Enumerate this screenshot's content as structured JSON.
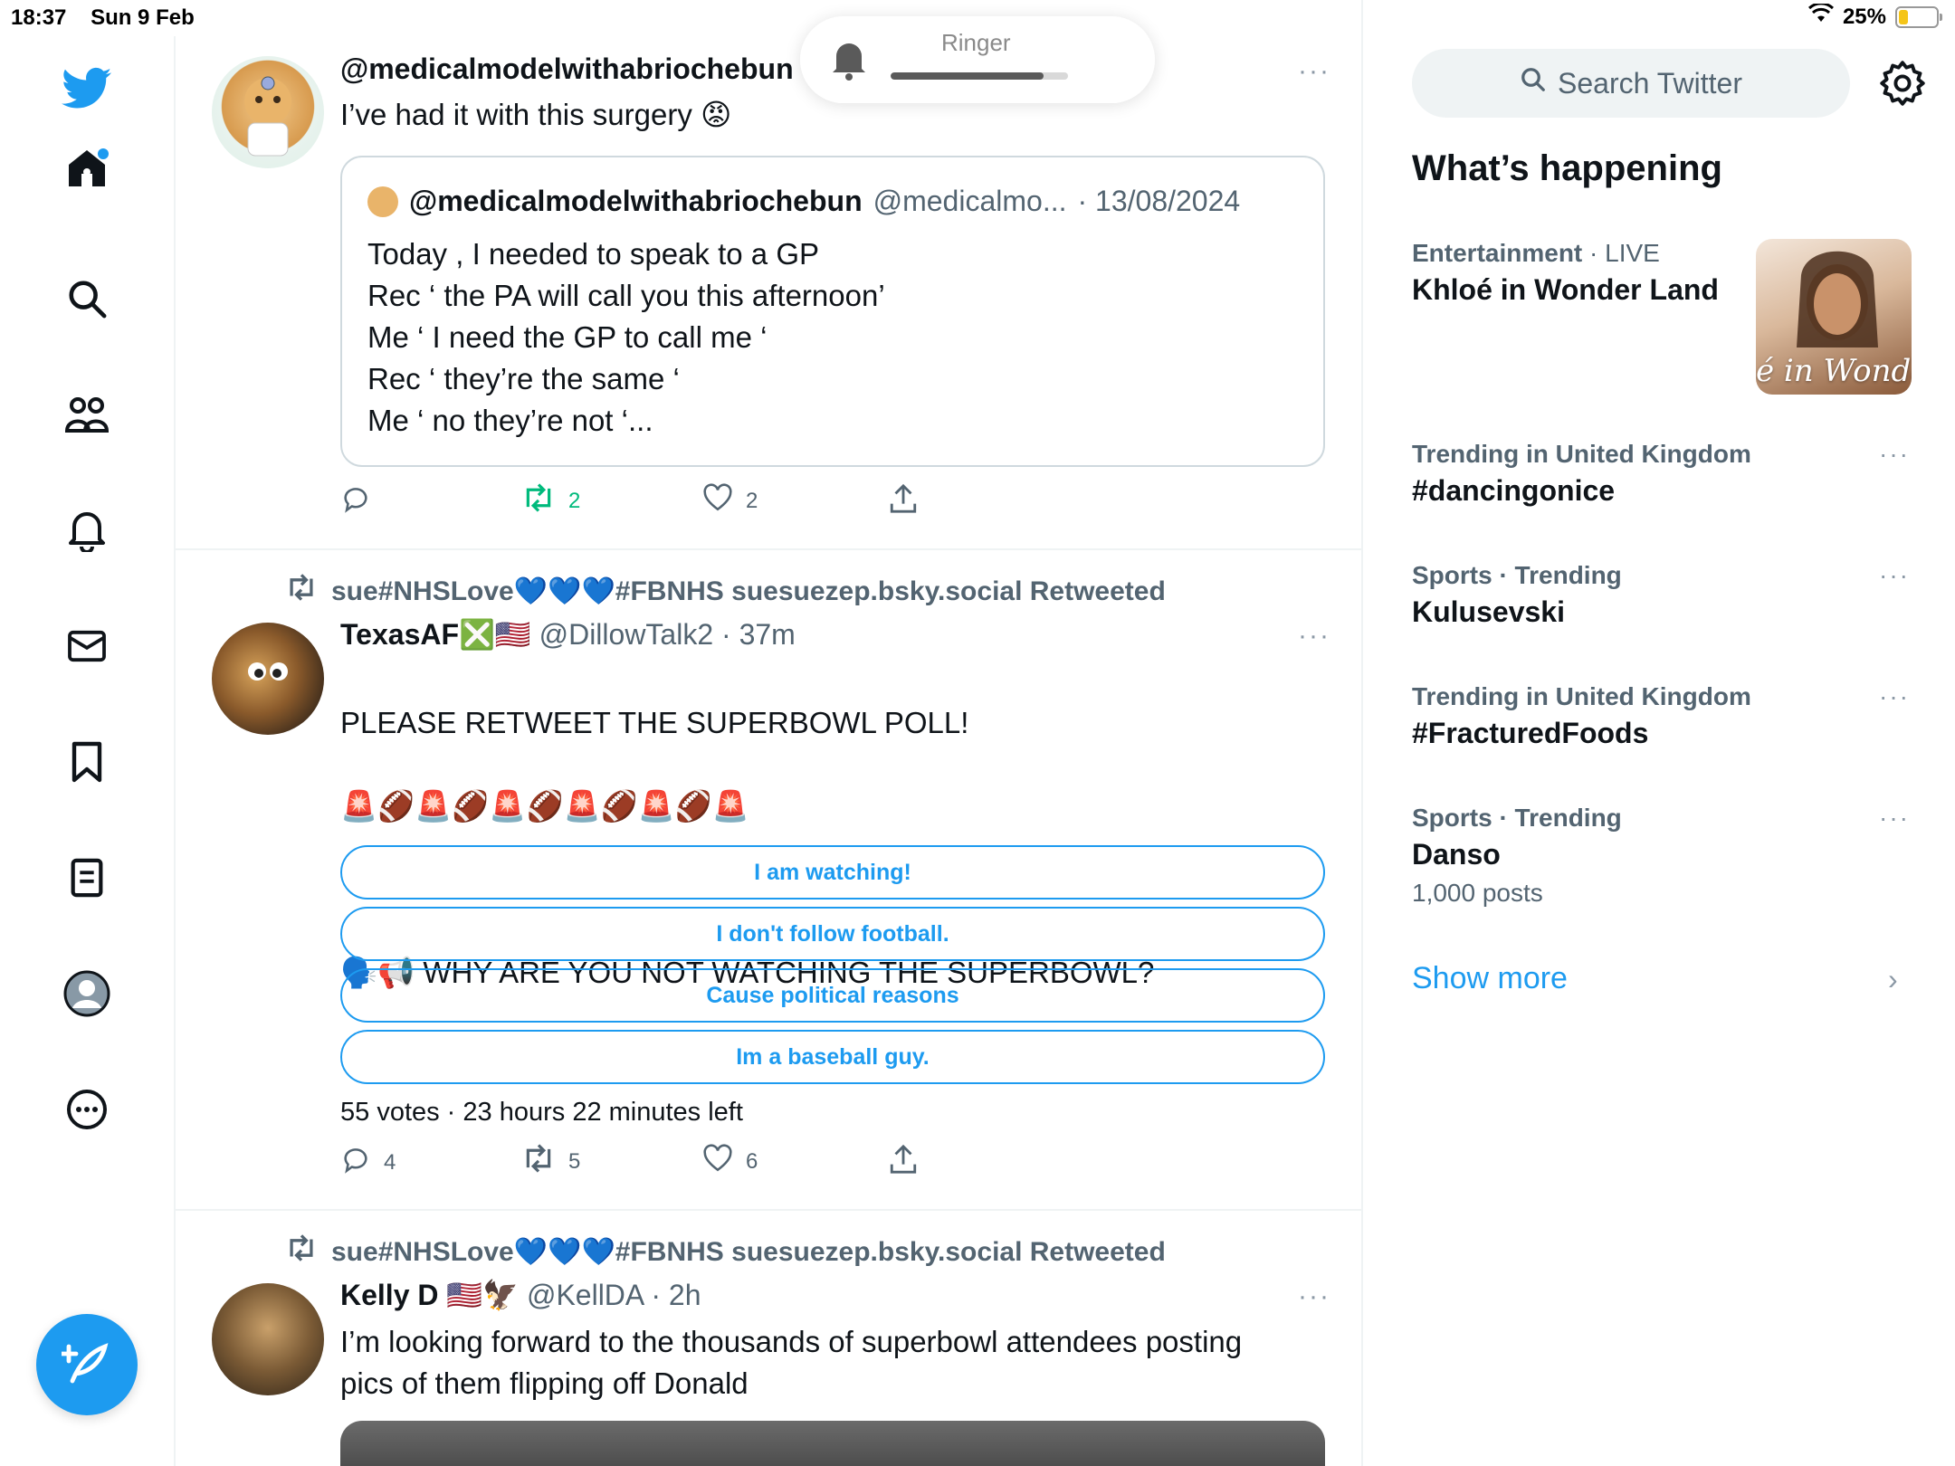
{
  "status_bar": {
    "time": "18:37",
    "date": "Sun 9 Feb",
    "battery": "25%",
    "battery_level": 0.25
  },
  "ringer": {
    "label": "Ringer",
    "level": 0.86
  },
  "tweets": [
    {
      "handle_display": "@medicalmodelwithabriochebun",
      "text": "I’ve had it with this surgery 😡",
      "quote": {
        "name": "@medicalmodelwithabriochebun",
        "handle": "@medicalmo...",
        "date": "· 13/08/2024",
        "text": "Today , I needed to speak to a GP\nRec ‘ the PA will call you this afternoon’\nMe ‘ I need the GP to call me ‘\nRec ‘ they’re the same ‘\nMe ‘ no they’re not ‘..."
      },
      "actions": {
        "reply": "",
        "retweet": "2",
        "like": "2"
      }
    },
    {
      "retweeted_by": "sue#NHSLove💙💙💙#FBNHS suesuezep.bsky.social Retweeted",
      "name": "TexasAF❎🇺🇸",
      "handle": "@DillowTalk2",
      "time": "· 37m",
      "text_line1": "PLEASE RETWEET THE SUPERBOWL POLL!",
      "text_line2": "🚨🏈🚨🏈🚨🏈🚨🏈🚨🏈🚨",
      "text_line3": "🗣️📢  WHY ARE YOU  NOT WATCHING THE SUPERBOWL?",
      "poll": {
        "options": [
          "I am watching!",
          "I don't follow football.",
          "Cause political reasons",
          "Im a baseball guy."
        ],
        "summary": "55 votes · 23 hours 22 minutes left"
      },
      "actions": {
        "reply": "4",
        "retweet": "5",
        "like": "6"
      }
    },
    {
      "retweeted_by": "sue#NHSLove💙💙💙#FBNHS suesuezep.bsky.social Retweeted",
      "name": "Kelly D 🇺🇸🦅",
      "handle": "@KellDA",
      "time": "· 2h",
      "text": "I’m looking forward to the thousands of superbowl attendees posting\npics of them flipping off Donald"
    }
  ],
  "sidebar": {
    "search_placeholder": "Search Twitter",
    "section_title": "What’s happening",
    "trends": [
      {
        "category": "Entertainment",
        "live": "· LIVE",
        "title": "Khloé in Wonder Land",
        "thumb_text": "é in Wonder L"
      },
      {
        "category": "Trending in United Kingdom",
        "title": "#dancingonice"
      },
      {
        "category": "Sports · Trending",
        "title": "Kulusevski"
      },
      {
        "category": "Trending in United Kingdom",
        "title": "#FracturedFoods"
      },
      {
        "category": "Sports · Trending",
        "title": "Danso",
        "sub": "1,000 posts"
      }
    ],
    "show_more": "Show more"
  },
  "more_glyph": "···",
  "colors": {
    "accent": "#1d9bf0",
    "retweet_green": "#00ba7c",
    "muted": "#536471",
    "border": "#eff3f4"
  }
}
